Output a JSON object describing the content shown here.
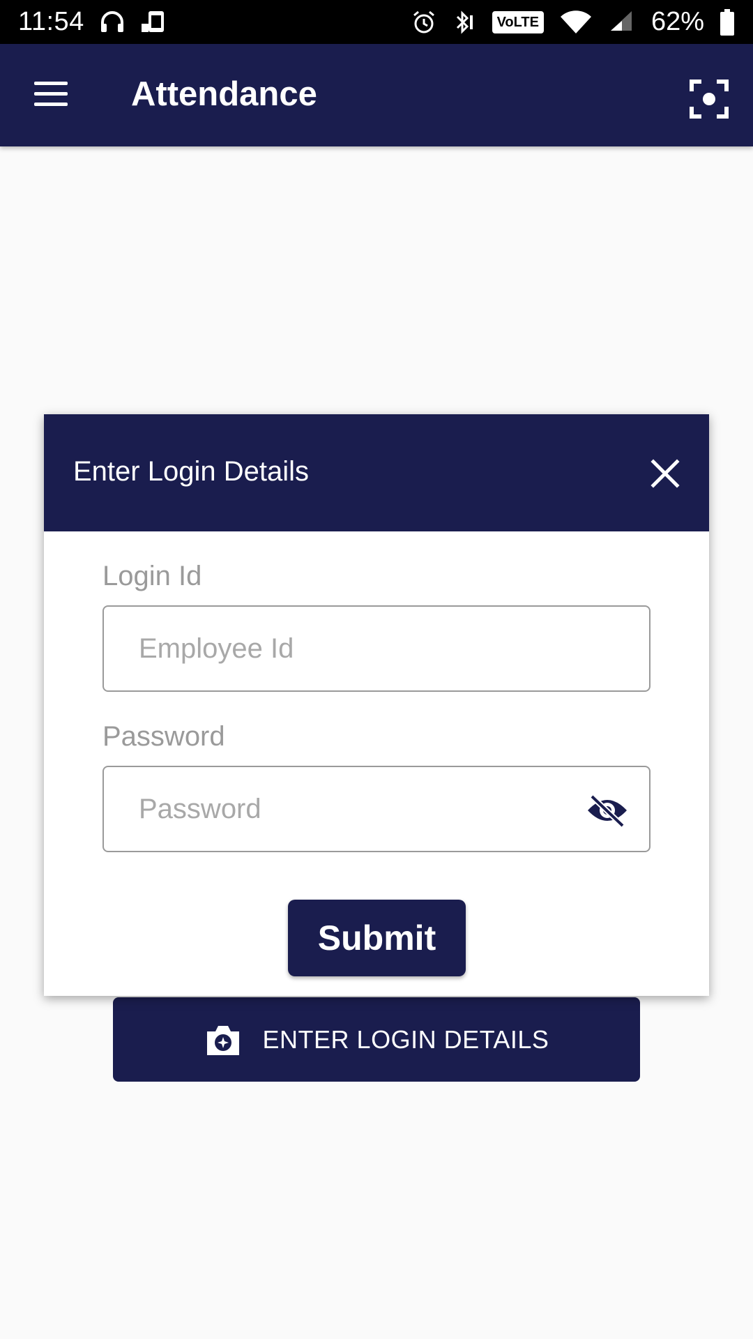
{
  "status_bar": {
    "time": "11:54",
    "volte": "VoLTE",
    "battery": "62%"
  },
  "app_bar": {
    "title": "Attendance",
    "menu_icon": "menu-icon",
    "scan_icon": "scan-icon"
  },
  "modal": {
    "title": "Enter Login Details",
    "close_icon": "close-icon",
    "login_id_label": "Login Id",
    "login_id_placeholder": "Employee Id",
    "password_label": "Password",
    "password_placeholder": "Password",
    "visibility_icon": "eye-off-icon",
    "submit_label": "Submit"
  },
  "main": {
    "login_button_label": "ENTER LOGIN DETAILS",
    "login_button_icon": "camera-icon"
  },
  "colors": {
    "primary": "#1a1d4e",
    "background": "#fafafa",
    "label_gray": "#9a9a9a"
  }
}
